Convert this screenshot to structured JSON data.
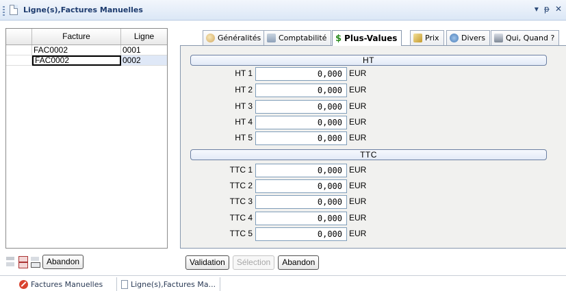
{
  "window": {
    "title": "Ligne(s),Factures Manuelles",
    "controls": [
      "▾",
      "ᵽ",
      "✕"
    ]
  },
  "grid": {
    "headers": [
      "Facture",
      "Ligne"
    ],
    "rows": [
      {
        "facture": "FAC0002",
        "ligne": "0001"
      },
      {
        "facture": "FAC0002",
        "ligne": "0002"
      }
    ]
  },
  "left_toolbar": {
    "abandon_label": "Abandon"
  },
  "tabs": [
    {
      "label": "Généralités",
      "icon": "generalites-icon"
    },
    {
      "label": "Comptabilité",
      "icon": "comptabilite-icon"
    },
    {
      "label": "Plus-Values",
      "icon": "dollar-icon",
      "active": true
    },
    {
      "label": "Prix",
      "icon": "prix-icon"
    },
    {
      "label": "Divers",
      "icon": "divers-icon"
    },
    {
      "label": "Qui, Quand ?",
      "icon": "qui-quand-icon"
    }
  ],
  "sections": {
    "ht": {
      "title": "HT",
      "rows": [
        {
          "label": "HT 1",
          "value": "0,000",
          "unit": "EUR"
        },
        {
          "label": "HT 2",
          "value": "0,000",
          "unit": "EUR"
        },
        {
          "label": "HT 3",
          "value": "0,000",
          "unit": "EUR"
        },
        {
          "label": "HT 4",
          "value": "0,000",
          "unit": "EUR"
        },
        {
          "label": "HT 5",
          "value": "0,000",
          "unit": "EUR"
        }
      ]
    },
    "ttc": {
      "title": "TTC",
      "rows": [
        {
          "label": "TTC 1",
          "value": "0,000",
          "unit": "EUR"
        },
        {
          "label": "TTC 2",
          "value": "0,000",
          "unit": "EUR"
        },
        {
          "label": "TTC 3",
          "value": "0,000",
          "unit": "EUR"
        },
        {
          "label": "TTC 4",
          "value": "0,000",
          "unit": "EUR"
        },
        {
          "label": "TTC 5",
          "value": "0,000",
          "unit": "EUR"
        }
      ]
    }
  },
  "right_toolbar": {
    "validation_label": "Validation",
    "selection_label": "Sélection",
    "abandon_label": "Abandon"
  },
  "bottom_tabs": [
    {
      "label": "Factures Manuelles",
      "icon": "stop-icon"
    },
    {
      "label": "Ligne(s),Factures Ma...",
      "icon": "document-icon"
    }
  ]
}
